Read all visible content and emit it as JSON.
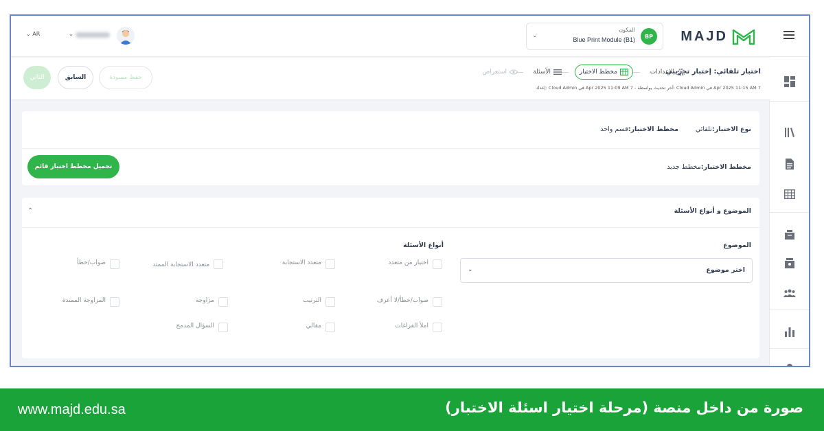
{
  "topbar": {
    "lang": "AR",
    "logo_text": "MAJD",
    "module_label": "المكون",
    "module_value": "Blue Print Module (B1)",
    "module_badge": "BP"
  },
  "steps": {
    "quiz_title": "اختبار تلقائي: إختبار تجريبي",
    "settings": "الإعدادات",
    "blueprint": "مخطط الاختبار",
    "questions": "الأسئلة",
    "preview": "استعراض",
    "meta": "إعداد: Cloud Admin في Apr 2025 11:09 AM 7 - آخر تحديث بواسطة: Cloud Admin في Apr 2025 11:15 AM 7",
    "btn_next": "التالي",
    "btn_prev": "السابق",
    "btn_draft": "حفظ مسودة"
  },
  "blueprint_card": {
    "quiz_type_label": "نوع الاختبار",
    "quiz_type_value": "تلقائي",
    "blueprint_label": "مخطط الاختبار",
    "blueprint_value": "قسم واحد",
    "blueprint2_label": "مخطط الاختبار",
    "blueprint2_value": "مخطط جديد",
    "load_button": "تحميل مخطط اختبار قائم"
  },
  "topics_card": {
    "title": "الموضوع و أنواع الأسئلة",
    "topic_label": "الموضوع",
    "topic_placeholder": "اختر موضوع",
    "qtypes_label": "أنواع الأسئلة",
    "qtypes": [
      "اختيار من متعدد",
      "متعدد الاستجابة",
      "متعدد الاستجابة الممتد",
      "صواب/خطأ",
      "صواب/خطأ/لا أعرف",
      "الترتيب",
      "مزاوجة",
      "المزاوجة الممتدة",
      "املأ الفراغات",
      "مقالي",
      "السؤال المدمج"
    ]
  },
  "footer": {
    "url": "www.majd.edu.sa",
    "caption": "صورة من داخل منصة (مرحلة اختيار اسئلة الاختبار)"
  },
  "colors": {
    "accent": "#2fb54a",
    "footer_bg": "#19a339",
    "frame_border": "#6a86c9"
  }
}
